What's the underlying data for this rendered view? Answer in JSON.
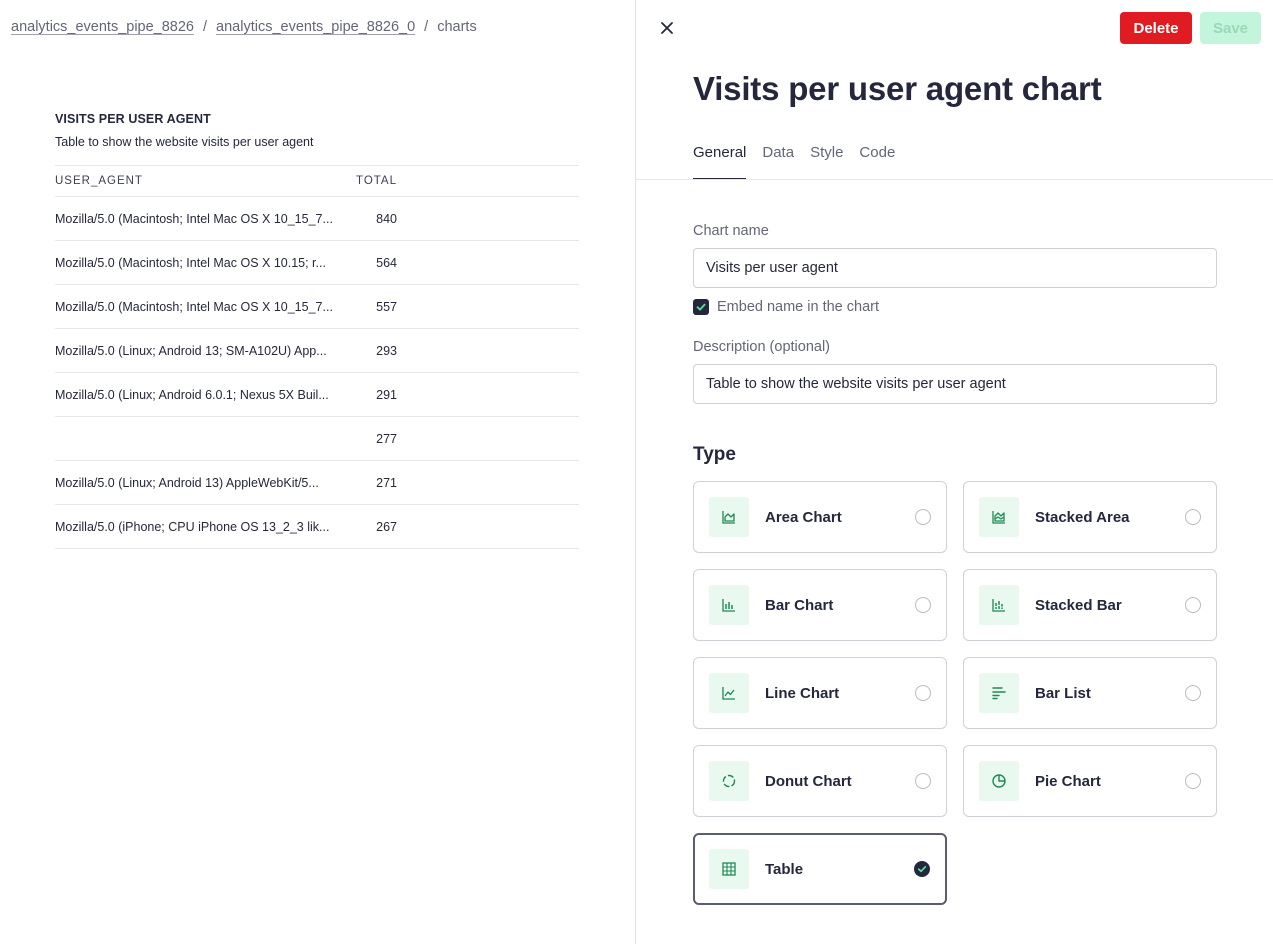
{
  "breadcrumb": {
    "items": [
      "analytics_events_pipe_8826",
      "analytics_events_pipe_8826_0"
    ],
    "current": "charts"
  },
  "preview": {
    "title": "VISITS PER USER AGENT",
    "description": "Table to show the website visits per user agent",
    "columns": [
      "USER_AGENT",
      "TOTAL"
    ],
    "rows": [
      [
        "Mozilla/5.0 (Macintosh; Intel Mac OS X 10_15_7...",
        "840"
      ],
      [
        "Mozilla/5.0 (Macintosh; Intel Mac OS X 10.15; r...",
        "564"
      ],
      [
        "Mozilla/5.0 (Macintosh; Intel Mac OS X 10_15_7...",
        "557"
      ],
      [
        "Mozilla/5.0 (Linux; Android 13; SM-A102U) App...",
        "293"
      ],
      [
        "Mozilla/5.0 (Linux; Android 6.0.1; Nexus 5X Buil...",
        "291"
      ],
      [
        "",
        "277"
      ],
      [
        "Mozilla/5.0 (Linux; Android 13) AppleWebKit/5...",
        "271"
      ],
      [
        "Mozilla/5.0 (iPhone; CPU iPhone OS 13_2_3 lik...",
        "267"
      ]
    ]
  },
  "panel": {
    "title": "Visits per user agent chart",
    "delete_label": "Delete",
    "save_label": "Save",
    "tabs": [
      {
        "label": "General",
        "active": true
      },
      {
        "label": "Data",
        "active": false
      },
      {
        "label": "Style",
        "active": false
      },
      {
        "label": "Code",
        "active": false
      }
    ],
    "chart_name_label": "Chart name",
    "chart_name_value": "Visits per user agent",
    "embed_label": "Embed name in the chart",
    "embed_checked": true,
    "description_label": "Description (optional)",
    "description_value": "Table to show the website visits per user agent",
    "type_heading": "Type",
    "types": [
      {
        "label": "Area Chart",
        "icon": "area-chart-icon",
        "selected": false
      },
      {
        "label": "Stacked Area",
        "icon": "stacked-area-icon",
        "selected": false
      },
      {
        "label": "Bar Chart",
        "icon": "bar-chart-icon",
        "selected": false
      },
      {
        "label": "Stacked Bar",
        "icon": "stacked-bar-icon",
        "selected": false
      },
      {
        "label": "Line Chart",
        "icon": "line-chart-icon",
        "selected": false
      },
      {
        "label": "Bar List",
        "icon": "bar-list-icon",
        "selected": false
      },
      {
        "label": "Donut Chart",
        "icon": "donut-chart-icon",
        "selected": false
      },
      {
        "label": "Pie Chart",
        "icon": "pie-chart-icon",
        "selected": false
      },
      {
        "label": "Table",
        "icon": "table-icon",
        "selected": true
      }
    ]
  },
  "colors": {
    "accent_dark": "#25283d",
    "delete_red": "#e11b22",
    "save_disabled": "#c2f5dc",
    "icon_bg": "#e9f9f0",
    "icon_green": "#1f8a52"
  }
}
